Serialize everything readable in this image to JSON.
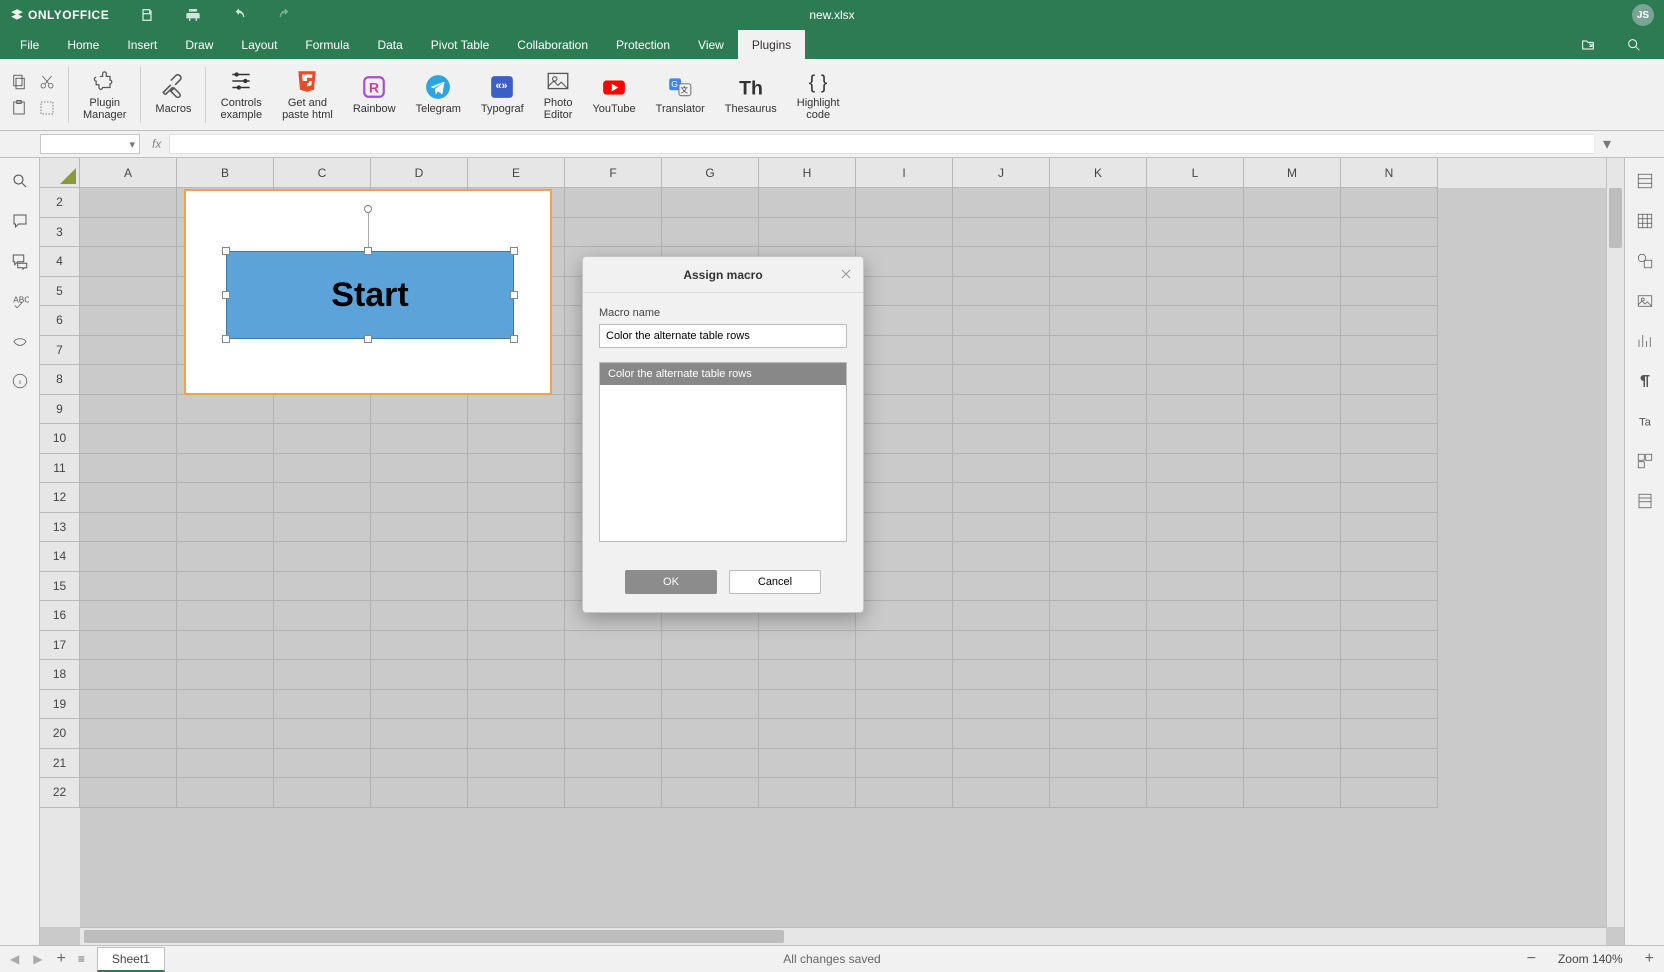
{
  "app": {
    "brand": "ONLYOFFICE",
    "doc_title": "new.xlsx",
    "avatar": "JS"
  },
  "menu": {
    "tabs": [
      "File",
      "Home",
      "Insert",
      "Draw",
      "Layout",
      "Formula",
      "Data",
      "Pivot Table",
      "Collaboration",
      "Protection",
      "View",
      "Plugins"
    ],
    "active": "Plugins"
  },
  "ribbon": {
    "plugin_manager": "Plugin\nManager",
    "macros": "Macros",
    "controls_example": "Controls\nexample",
    "get_paste_html": "Get and\npaste html",
    "rainbow": "Rainbow",
    "telegram": "Telegram",
    "typograf": "Typograf",
    "photo_editor": "Photo\nEditor",
    "youtube": "YouTube",
    "translator": "Translator",
    "thesaurus": "Thesaurus",
    "highlight_code": "Highlight\ncode"
  },
  "grid": {
    "columns": [
      "A",
      "B",
      "C",
      "D",
      "E",
      "F",
      "G",
      "H",
      "I",
      "J",
      "K",
      "L",
      "M",
      "N"
    ],
    "rows": [
      2,
      3,
      4,
      5,
      6,
      7,
      8,
      9,
      10,
      11,
      12,
      13,
      14,
      15,
      16,
      17,
      18,
      19,
      20,
      21,
      22
    ],
    "shape_text": "Start"
  },
  "sheets": {
    "active": "Sheet1"
  },
  "status": {
    "saved": "All changes saved",
    "zoom_label": "Zoom 140%"
  },
  "dialog": {
    "title": "Assign macro",
    "label_macro_name": "Macro name",
    "input_value": "Color the alternate table rows",
    "list": [
      "Color the alternate table rows"
    ],
    "ok": "OK",
    "cancel": "Cancel"
  }
}
